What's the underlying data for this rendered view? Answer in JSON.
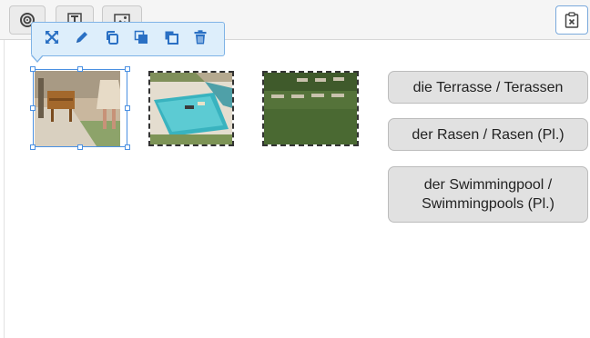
{
  "toolbar": {
    "buttons": [
      {
        "icon": "target-icon"
      },
      {
        "icon": "text-icon"
      },
      {
        "icon": "image-icon"
      }
    ],
    "right_button_icon": "clipboard-x-icon"
  },
  "popup_toolbar": {
    "actions": [
      {
        "name": "expand",
        "icon": "expand-icon"
      },
      {
        "name": "edit",
        "icon": "pencil-icon"
      },
      {
        "name": "duplicate",
        "icon": "copy-icon"
      },
      {
        "name": "bring-forward",
        "icon": "bring-forward-icon"
      },
      {
        "name": "send-backward",
        "icon": "send-backward-icon"
      },
      {
        "name": "delete",
        "icon": "trash-icon"
      }
    ],
    "accent_color": "#2a70c4"
  },
  "images": [
    {
      "name": "terrace-image",
      "selected": true
    },
    {
      "name": "pool-image",
      "selected": false
    },
    {
      "name": "lawn-image",
      "selected": false
    }
  ],
  "answers": [
    {
      "label": "die Terrasse / Terassen"
    },
    {
      "label": "der Rasen / Rasen (Pl.)"
    },
    {
      "label": "der Swimmingpool / Swimmingpools (Pl.)"
    }
  ]
}
